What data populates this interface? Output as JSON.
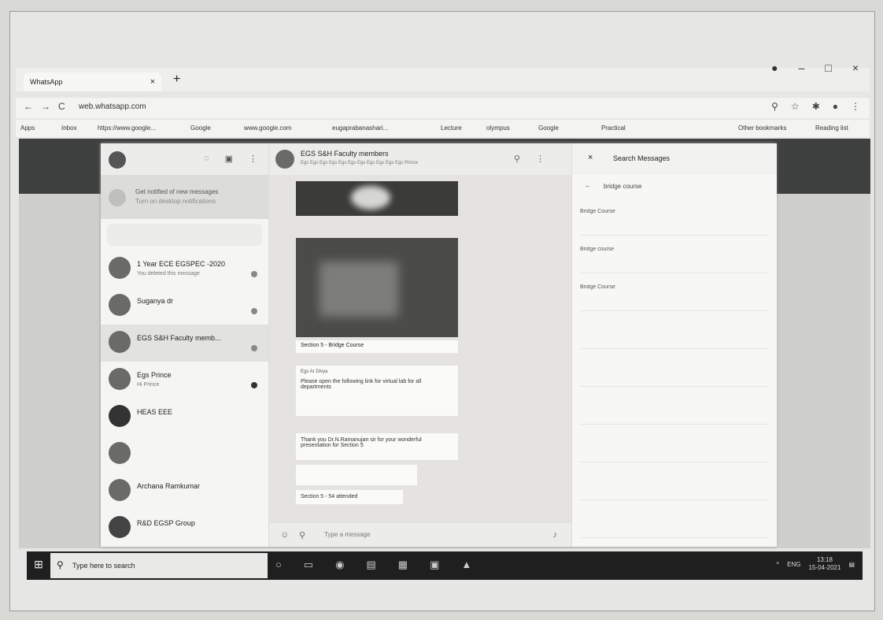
{
  "browser": {
    "tab_title": "WhatsApp",
    "url": "web.whatsapp.com",
    "bookmarks": [
      "Apps",
      "Inbox",
      "https://www.google...",
      "Google",
      "www.google.com",
      "eugaprabanashari...",
      "Lecture",
      "olympus",
      "Google",
      "Practical",
      "Other bookmarks",
      "Reading list"
    ]
  },
  "sidebar": {
    "notification_title": "Get notified of new messages",
    "notification_sub": "Turn on desktop notifications",
    "chats": [
      {
        "name": "1 Year ECE EGSPEC -2020",
        "preview": "You deleted this message",
        "time": "",
        "active": false
      },
      {
        "name": "Suganya dr",
        "preview": "",
        "time": "",
        "active": false
      },
      {
        "name": "EGS S&H Faculty memb...",
        "preview": "",
        "time": "",
        "active": true
      },
      {
        "name": "Egs Prince",
        "preview": "Hi Prince",
        "time": "",
        "active": false
      },
      {
        "name": "HEAS EEE",
        "preview": "",
        "time": "",
        "active": false
      },
      {
        "name": "",
        "preview": "",
        "time": "",
        "active": false
      },
      {
        "name": "Archana Ramkumar",
        "preview": "",
        "time": "",
        "active": false
      },
      {
        "name": "R&D EGSP Group",
        "preview": "",
        "time": "",
        "active": false
      }
    ]
  },
  "conversation": {
    "title": "EGS S&H Faculty members",
    "subtitle": "Egs Egs Egs Egs Egs Egs Egs Egs Egs Egs Egs Prince",
    "caption": "Section 5 - Bridge Course",
    "msg1_sender": "Egs Ar Divya",
    "msg1_text": "Please open the following link for virtual lab for all departments",
    "msg2_text": "Thank you Dr.N.Ramanujan sir for your wonderful presentation for Section 5",
    "msg3_text": "Section 5 - 54 attended",
    "composer_placeholder": "Type a message"
  },
  "search_panel": {
    "title": "Search Messages",
    "query": "bridge course",
    "results": [
      {
        "date": "",
        "text": "Bridge Course"
      },
      {
        "date": "",
        "text": "Bridge course"
      },
      {
        "date": "",
        "text": "Bridge Course"
      },
      {
        "date": "",
        "text": ""
      },
      {
        "date": "",
        "text": ""
      },
      {
        "date": "",
        "text": ""
      },
      {
        "date": "",
        "text": ""
      },
      {
        "date": "",
        "text": ""
      },
      {
        "date": "",
        "text": ""
      }
    ]
  },
  "taskbar": {
    "search_placeholder": "Type here to search",
    "lang": "ENG",
    "time": "13:18",
    "date": "15-04-2021"
  }
}
